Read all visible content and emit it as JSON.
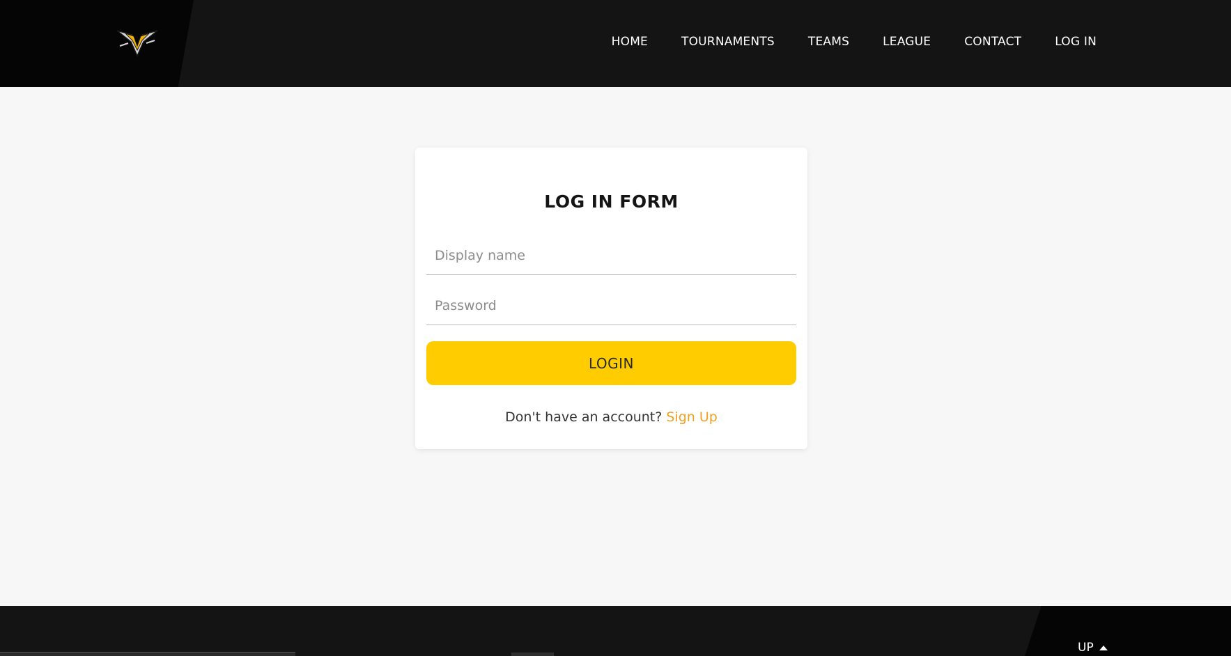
{
  "header": {
    "logo_icon": "v-wing-logo-icon",
    "nav": [
      {
        "label": "HOME"
      },
      {
        "label": "TOURNAMENTS"
      },
      {
        "label": "TEAMS"
      },
      {
        "label": "LEAGUE"
      },
      {
        "label": "CONTACT"
      },
      {
        "label": "LOG IN"
      }
    ]
  },
  "login_form": {
    "title": "LOG IN FORM",
    "display_name_placeholder": "Display name",
    "display_name_value": "",
    "password_placeholder": "Password",
    "password_value": "",
    "login_button": "LOGIN",
    "no_account_text": "Don't have an account?",
    "signup_link": "Sign Up"
  },
  "footer": {
    "up_label": "UP",
    "up_icon": "caret-up-icon"
  },
  "colors": {
    "header_bg": "#141414",
    "accent_yellow": "#ffcc00",
    "link_orange": "#f0a020",
    "page_bg": "#f7f7f7"
  }
}
